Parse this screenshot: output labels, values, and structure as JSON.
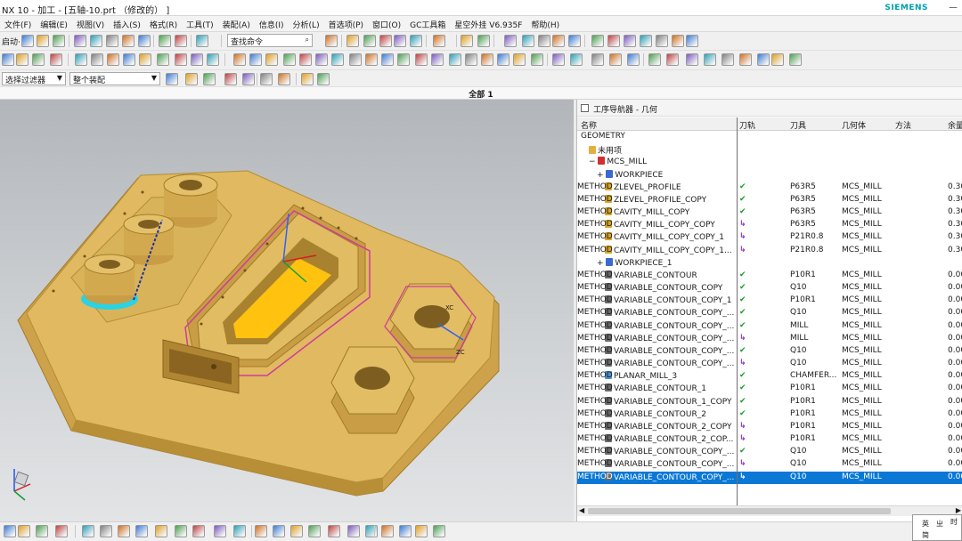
{
  "window": {
    "title": "NX 10 - 加工 - [五轴-10.prt （修改的） ]",
    "brand": "SIEMENS",
    "controls": "－"
  },
  "menu": [
    "文件(F)",
    "编辑(E)",
    "视图(V)",
    "插入(S)",
    "格式(R)",
    "工具(T)",
    "装配(A)",
    "信息(I)",
    "分析(L)",
    "首选项(P)",
    "窗口(O)",
    "GC工具箱",
    "星空外挂 V6.935F",
    "帮助(H)"
  ],
  "toolbar": {
    "start_label": "启动·",
    "command_search": "查找命令",
    "selection_filter": "选择过滤器",
    "assembly_scope": "整个装配"
  },
  "viewport": {
    "title": "全部 1",
    "axis_labels": {
      "zc": "ZC",
      "xc": "XC",
      "yc": "YC"
    }
  },
  "navigator": {
    "title": "工序导航器 - 几何",
    "columns": [
      "名称",
      "刀轨",
      "刀具",
      "几何体",
      "方法",
      "余量"
    ],
    "rows": [
      {
        "name": "GEOMETRY",
        "track": "",
        "tool": "",
        "geom": "",
        "method": "",
        "rem": "",
        "indent": 0,
        "icon": "none"
      },
      {
        "name": "未用项",
        "track": "",
        "tool": "",
        "geom": "",
        "method": "",
        "rem": "",
        "indent": 1,
        "icon": "folder"
      },
      {
        "name": "MCS_MILL",
        "track": "",
        "tool": "",
        "geom": "",
        "method": "",
        "rem": "",
        "indent": 1,
        "icon": "mcs",
        "expander": "−"
      },
      {
        "name": "WORKPIECE",
        "track": "",
        "tool": "",
        "geom": "",
        "method": "",
        "rem": "",
        "indent": 2,
        "icon": "workpiece",
        "expander": "+"
      },
      {
        "name": "ZLEVEL_PROFILE",
        "track": "✔",
        "tool": "P63R5",
        "geom": "MCS_MILL",
        "method": "METHOD",
        "rem": "0.30",
        "indent": 3,
        "icon": "op",
        "status": "ok"
      },
      {
        "name": "ZLEVEL_PROFILE_COPY",
        "track": "✔",
        "tool": "P63R5",
        "geom": "MCS_MILL",
        "method": "METHOD",
        "rem": "0.30",
        "indent": 3,
        "icon": "op",
        "status": "ok"
      },
      {
        "name": "CAVITY_MILL_COPY",
        "track": "✔",
        "tool": "P63R5",
        "geom": "MCS_MILL",
        "method": "METHOD",
        "rem": "0.30",
        "indent": 3,
        "icon": "op",
        "status": "ok"
      },
      {
        "name": "CAVITY_MILL_COPY_COPY",
        "track": "↳",
        "tool": "P63R5",
        "geom": "MCS_MILL",
        "method": "METHOD",
        "rem": "0.30",
        "indent": 3,
        "icon": "op",
        "status": "chg"
      },
      {
        "name": "CAVITY_MILL_COPY_COPY_1",
        "track": "↳",
        "tool": "P21R0.8",
        "geom": "MCS_MILL",
        "method": "METHOD",
        "rem": "0.30",
        "indent": 3,
        "icon": "op",
        "status": "chg"
      },
      {
        "name": "CAVITY_MILL_COPY_COPY_1...",
        "track": "↳",
        "tool": "P21R0.8",
        "geom": "MCS_MILL",
        "method": "METHOD",
        "rem": "0.30",
        "indent": 3,
        "icon": "op",
        "status": "chg"
      },
      {
        "name": "WORKPIECE_1",
        "track": "",
        "tool": "",
        "geom": "",
        "method": "",
        "rem": "",
        "indent": 2,
        "icon": "workpiece",
        "expander": "+"
      },
      {
        "name": "VARIABLE_CONTOUR",
        "track": "✔",
        "tool": "P10R1",
        "geom": "MCS_MILL",
        "method": "METHOD",
        "rem": "0.00",
        "indent": 3,
        "icon": "var",
        "status": "ok"
      },
      {
        "name": "VARIABLE_CONTOUR_COPY",
        "track": "✔",
        "tool": "Q10",
        "geom": "MCS_MILL",
        "method": "METHOD",
        "rem": "0.00",
        "indent": 3,
        "icon": "var",
        "status": "ok"
      },
      {
        "name": "VARIABLE_CONTOUR_COPY_1",
        "track": "✔",
        "tool": "P10R1",
        "geom": "MCS_MILL",
        "method": "METHOD",
        "rem": "0.00",
        "indent": 3,
        "icon": "var",
        "status": "ok"
      },
      {
        "name": "VARIABLE_CONTOUR_COPY_...",
        "track": "✔",
        "tool": "Q10",
        "geom": "MCS_MILL",
        "method": "METHOD",
        "rem": "0.00",
        "indent": 3,
        "icon": "var",
        "status": "ok"
      },
      {
        "name": "VARIABLE_CONTOUR_COPY_...",
        "track": "✔",
        "tool": "MILL",
        "geom": "MCS_MILL",
        "method": "METHOD",
        "rem": "0.00",
        "indent": 3,
        "icon": "var",
        "status": "ok"
      },
      {
        "name": "VARIABLE_CONTOUR_COPY_...",
        "track": "↳",
        "tool": "MILL",
        "geom": "MCS_MILL",
        "method": "METHOD",
        "rem": "0.00",
        "indent": 3,
        "icon": "var",
        "status": "chg"
      },
      {
        "name": "VARIABLE_CONTOUR_COPY_...",
        "track": "✔",
        "tool": "Q10",
        "geom": "MCS_MILL",
        "method": "METHOD",
        "rem": "0.00",
        "indent": 3,
        "icon": "var",
        "status": "ok"
      },
      {
        "name": "VARIABLE_CONTOUR_COPY_...",
        "track": "↳",
        "tool": "Q10",
        "geom": "MCS_MILL",
        "method": "METHOD",
        "rem": "0.00",
        "indent": 3,
        "icon": "var",
        "status": "chg"
      },
      {
        "name": "PLANAR_MILL_3",
        "track": "✔",
        "tool": "CHAMFER...",
        "geom": "MCS_MILL",
        "method": "METHOD",
        "rem": "0.00",
        "indent": 3,
        "icon": "planar",
        "status": "ok"
      },
      {
        "name": "VARIABLE_CONTOUR_1",
        "track": "✔",
        "tool": "P10R1",
        "geom": "MCS_MILL",
        "method": "METHOD",
        "rem": "0.00",
        "indent": 3,
        "icon": "var",
        "status": "ok"
      },
      {
        "name": "VARIABLE_CONTOUR_1_COPY",
        "track": "✔",
        "tool": "P10R1",
        "geom": "MCS_MILL",
        "method": "METHOD",
        "rem": "0.00",
        "indent": 3,
        "icon": "var",
        "status": "ok"
      },
      {
        "name": "VARIABLE_CONTOUR_2",
        "track": "✔",
        "tool": "P10R1",
        "geom": "MCS_MILL",
        "method": "METHOD",
        "rem": "0.00",
        "indent": 3,
        "icon": "var",
        "status": "ok"
      },
      {
        "name": "VARIABLE_CONTOUR_2_COPY",
        "track": "↳",
        "tool": "P10R1",
        "geom": "MCS_MILL",
        "method": "METHOD",
        "rem": "0.00",
        "indent": 3,
        "icon": "var",
        "status": "chg"
      },
      {
        "name": "VARIABLE_CONTOUR_2_COP...",
        "track": "↳",
        "tool": "P10R1",
        "geom": "MCS_MILL",
        "method": "METHOD",
        "rem": "0.00",
        "indent": 3,
        "icon": "var",
        "status": "chg"
      },
      {
        "name": "VARIABLE_CONTOUR_COPY_...",
        "track": "✔",
        "tool": "Q10",
        "geom": "MCS_MILL",
        "method": "METHOD",
        "rem": "0.00",
        "indent": 3,
        "icon": "var",
        "status": "ok"
      },
      {
        "name": "VARIABLE_CONTOUR_COPY_...",
        "track": "↳",
        "tool": "Q10",
        "geom": "MCS_MILL",
        "method": "METHOD",
        "rem": "0.00",
        "indent": 3,
        "icon": "var",
        "status": "chg"
      },
      {
        "name": "VARIABLE_CONTOUR_COPY_...",
        "track": "↳",
        "tool": "Q10",
        "geom": "MCS_MILL",
        "method": "METHOD",
        "rem": "0.00",
        "indent": 3,
        "icon": "var",
        "status": "chg",
        "selected": true
      }
    ]
  },
  "ime": {
    "a": "英",
    "b": "ㄓ",
    "c": "简",
    "d": "时"
  },
  "colors": {
    "selection": "#0b78d6",
    "ok": "#1a9a2e",
    "changed": "#8a2bd0",
    "part": "#d8b458",
    "pocket_floor": "#ffc20e"
  }
}
